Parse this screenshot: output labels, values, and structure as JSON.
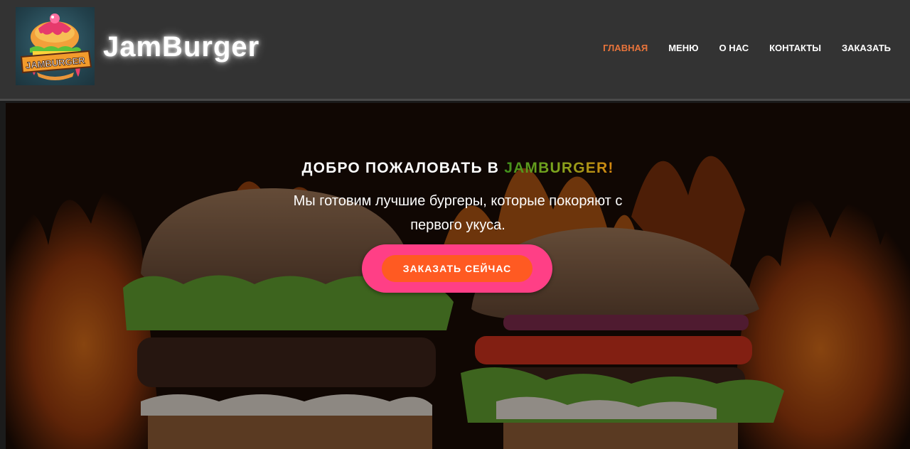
{
  "header": {
    "brand": "JamBurger",
    "logo_text": "JAMBURGER",
    "nav": [
      {
        "label": "ГЛАВНАЯ",
        "active": true
      },
      {
        "label": "МЕНЮ",
        "active": false
      },
      {
        "label": "О НАС",
        "active": false
      },
      {
        "label": "КОНТАКТЫ",
        "active": false
      },
      {
        "label": "ЗАКАЗАТЬ",
        "active": false
      }
    ]
  },
  "hero": {
    "title_prefix": "ДОБРО ПОЖАЛОВАТЬ В ",
    "title_accent": "JAMBURGER!",
    "subtitle": "Мы готовим лучшие бургеры, которые покоряют с первого укуса.",
    "cta_label": "ЗАКАЗАТЬ СЕЙЧАС"
  },
  "colors": {
    "header_bg": "#333333",
    "nav_active": "#e8743b",
    "cta_outer": "#ff3f86",
    "cta_inner": "#ff5a22"
  }
}
